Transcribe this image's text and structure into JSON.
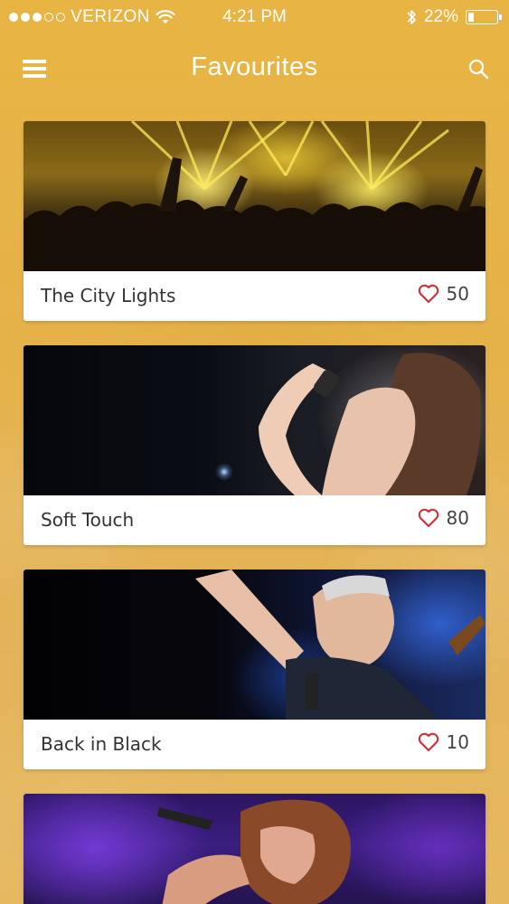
{
  "status_bar": {
    "carrier": "VERIZON",
    "time": "4:21 PM",
    "battery": "22%",
    "battery_level": 0.22,
    "signal_bars_filled": 3,
    "signal_bars_total": 5
  },
  "nav": {
    "title": "Favourites",
    "menu_icon": "hamburger-menu-icon",
    "search_icon": "search-icon"
  },
  "cards": [
    {
      "title": "The City Lights",
      "likes": "50",
      "image": "concert-crowd-lights"
    },
    {
      "title": "Soft Touch",
      "likes": "80",
      "image": "singer-with-microphone"
    },
    {
      "title": "Back in Black",
      "likes": "10",
      "image": "guitarist-singing"
    },
    {
      "title": "",
      "likes": "",
      "image": "singer-curly-hair"
    }
  ],
  "colors": {
    "background": "#e8b443",
    "heart": "#d9272e",
    "card": "#ffffff"
  }
}
